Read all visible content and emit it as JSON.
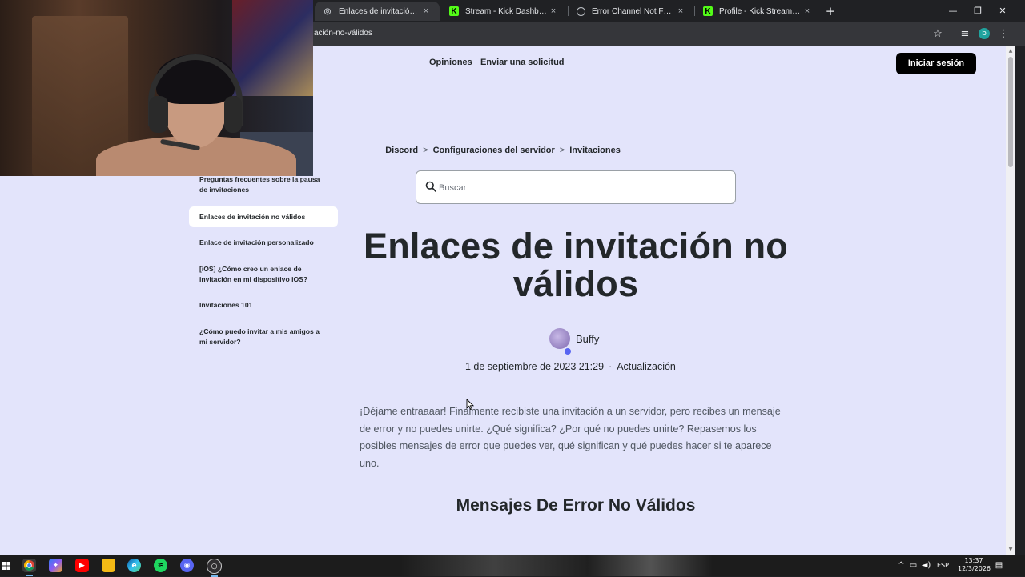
{
  "browser": {
    "tabs": [
      {
        "title": "Enlaces de invitación no válidos",
        "close": "×",
        "favicon": "discord-support-icon",
        "active": true
      },
      {
        "title": "Stream - Kick Dashboard",
        "close": "×",
        "favicon": "kick-icon",
        "active": false
      },
      {
        "title": "Error Channel Not Found",
        "close": "×",
        "favicon": "globe-icon",
        "active": false
      },
      {
        "title": "Profile - Kick Streaming",
        "close": "×",
        "favicon": "kick-icon",
        "active": false
      }
    ],
    "new_tab": "+",
    "url": "ación-no-válidos",
    "profile_initial": "b",
    "window_controls": {
      "minimize": "—",
      "restore": "❐",
      "close": "✕"
    }
  },
  "page": {
    "nav": {
      "opinions": "Opiniones",
      "submit_request": "Enviar una solicitud",
      "login": "Iniciar sesión"
    },
    "breadcrumb": [
      "Discord",
      "Configuraciones del servidor",
      "Invitaciones"
    ],
    "breadcrumb_sep": ">",
    "search": {
      "placeholder": "Buscar"
    },
    "sidebar": [
      {
        "label": "Preguntas frecuentes sobre la pausa de invitaciones",
        "active": false
      },
      {
        "label": "Enlaces de invitación no válidos",
        "active": true
      },
      {
        "label": "Enlace de invitación personalizado",
        "active": false
      },
      {
        "label": "[iOS] ¿Cómo creo un enlace de invitación en mi dispositivo iOS?",
        "active": false
      },
      {
        "label": "Invitaciones 101",
        "active": false
      },
      {
        "label": "¿Cómo puedo invitar a mis amigos a mi servidor?",
        "active": false
      }
    ],
    "article": {
      "title": "Enlaces de invitación no válidos",
      "author": "Buffy",
      "date": "1 de septiembre de 2023 21:29",
      "meta_sep": "·",
      "updated_label": "Actualización",
      "intro": "¡Déjame entraaaar! Finalmente recibiste una invitación a un servidor, pero recibes un mensaje de error y no puedes unirte. ¿Qué significa? ¿Por qué no puedes unirte? Repasemos los posibles mensajes de error que puedes ver, qué significan y qué puedes hacer si te aparece uno.",
      "section_heading": "Mensajes De Error No Válidos"
    }
  },
  "taskbar": {
    "apps": [
      "chrome-icon",
      "copilot-icon",
      "youtube-icon",
      "file-explorer-icon",
      "edge-icon",
      "spotify-icon",
      "discord-icon",
      "obs-icon"
    ],
    "language": "ESP",
    "time": "13:37",
    "date": "12/3/2026"
  },
  "colors": {
    "page_bg": "#e3e4fb",
    "login_bg": "#000000",
    "text": "#23272a",
    "muted_text": "#4f5660",
    "kick_green": "#53fc18"
  }
}
